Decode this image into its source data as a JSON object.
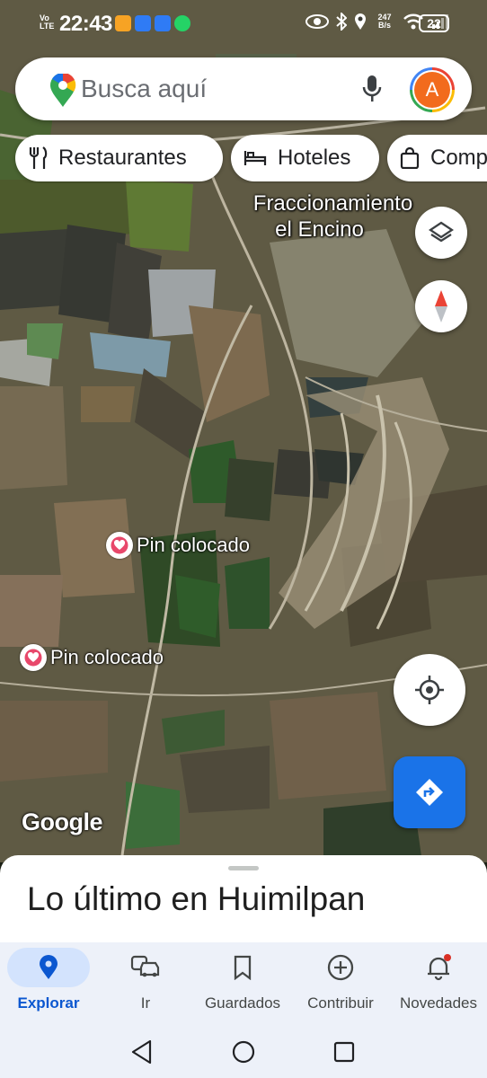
{
  "status_bar": {
    "network": "Vo LTE",
    "time": "22:43",
    "data_speed": "247 B/s",
    "battery": "22"
  },
  "search": {
    "placeholder": "Busca aquí",
    "avatar_initial": "A"
  },
  "chips": [
    {
      "label": "Restaurantes",
      "icon": "fork-knife-icon"
    },
    {
      "label": "Hoteles",
      "icon": "bed-icon"
    },
    {
      "label": "Comp",
      "icon": "shopping-bag-icon"
    }
  ],
  "map": {
    "place_label_line1": "Fraccionamiento",
    "place_label_line2": "el Encino",
    "pins": [
      {
        "label": "Pin colocado"
      },
      {
        "label": "Pin colocado"
      }
    ],
    "logo": "Google"
  },
  "sheet": {
    "title": "Lo último en Huimilpan"
  },
  "bottom_nav": [
    {
      "label": "Explorar",
      "icon": "location-pin-icon",
      "active": true
    },
    {
      "label": "Ir",
      "icon": "car-commute-icon",
      "active": false
    },
    {
      "label": "Guardados",
      "icon": "bookmark-icon",
      "active": false
    },
    {
      "label": "Contribuir",
      "icon": "add-circle-icon",
      "active": false
    },
    {
      "label": "Novedades",
      "icon": "bell-icon",
      "active": false
    }
  ],
  "colors": {
    "accent": "#1a73e8",
    "nav_active": "#0b57d0",
    "pin": "#e8486b"
  }
}
